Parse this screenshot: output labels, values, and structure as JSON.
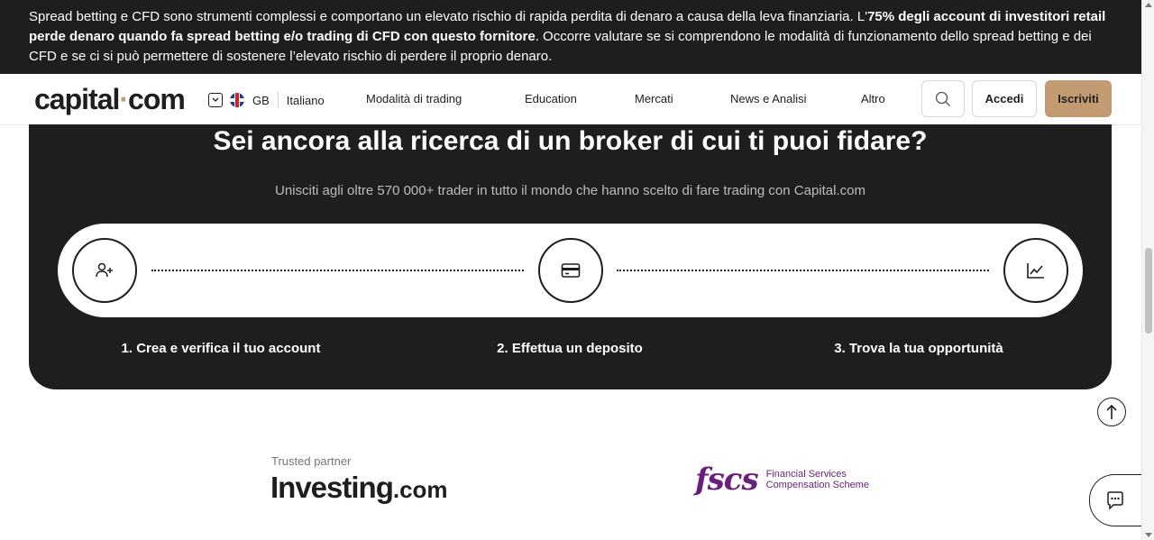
{
  "risk_banner": {
    "text_before": "Spread betting e CFD sono strumenti complessi e comportano un elevato rischio di rapida perdita di denaro a causa della leva finanziaria. L'",
    "text_bold": "75% degli account di investitori retail perde denaro quando fa spread betting e/o trading di CFD con questo fornitore",
    "text_after": ". Occorre valutare se si comprendono le modalità di funzionamento dello spread betting e dei CFD e se ci si può permettere di sostenere l’elevato rischio di perdere il proprio denaro."
  },
  "header": {
    "logo_left": "capital",
    "logo_dot": "·",
    "logo_right": "com",
    "region": "GB",
    "language": "Italiano",
    "nav": [
      "Modalità di trading",
      "Education",
      "Mercati",
      "News e Analisi",
      "Altro"
    ],
    "login_label": "Accedi",
    "signup_label": "Iscriviti",
    "accent_color": "#c29b73"
  },
  "hero": {
    "title": "Sei ancora alla ricerca di un broker di cui ti puoi fidare?",
    "subtitle": "Unisciti agli oltre 570 000+ trader in tutto il mondo che hanno scelto di fare trading con Capital.com",
    "steps": [
      {
        "icon": "add-user-icon",
        "label": "1. Crea e verifica il tuo account"
      },
      {
        "icon": "credit-card-icon",
        "label": "2. Effettua un deposito"
      },
      {
        "icon": "line-chart-icon",
        "label": "3. Trova la tua opportunità"
      }
    ]
  },
  "partners": {
    "trusted_label": "Trusted partner",
    "investing_name": "Investing",
    "investing_suffix": ".com",
    "fscs_mark": "fscs",
    "fscs_line1": "Financial Services",
    "fscs_line2": "Compensation Scheme"
  },
  "colors": {
    "dark": "#1e1e1e",
    "fscs_purple": "#6b1f7c"
  }
}
